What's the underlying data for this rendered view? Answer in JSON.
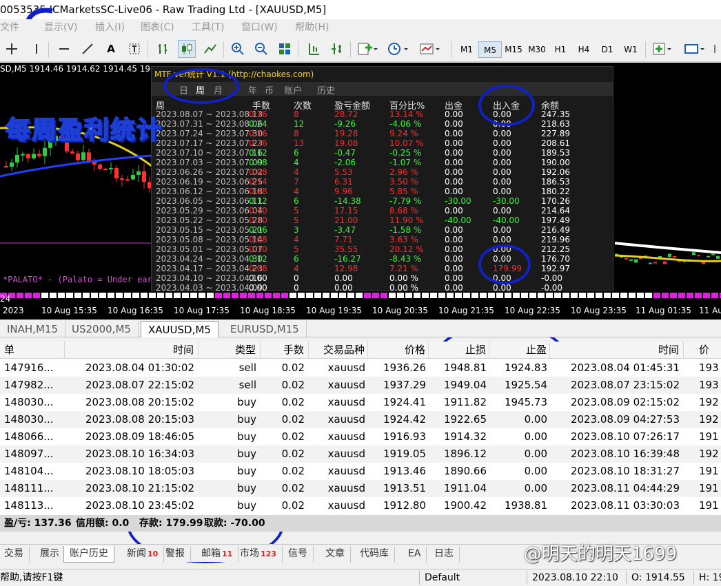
{
  "window": {
    "title": "0053535 ICMarketsSC-Live06 - Raw Trading Ltd - [XAUUSD,M5]"
  },
  "menu": {
    "items": [
      "文件",
      "显示(V)",
      "插入(I)",
      "图表(C)",
      "工具(T)",
      "窗口(W)",
      "帮助(H)"
    ]
  },
  "toolbar": {
    "timeframes": [
      "M1",
      "M5",
      "M15",
      "M30",
      "H1",
      "H4",
      "D1",
      "W1"
    ],
    "active_timeframe": "M5"
  },
  "chart": {
    "info": "SD,M5  1914.46 1914.62 1914.45 19",
    "indicator_text": "*PALATO* - (Palato = Under eart",
    "time_labels": [
      "24",
      "10 Aug 15:35",
      "10 Aug 16:35",
      "10 Aug 17:35",
      "10 Aug 18:35",
      "10 Aug 19:35",
      "10 Aug 20:35",
      "10 Aug 21:35",
      "10 Aug 22:35",
      "10 Aug 23:35",
      "11 Aug 01:35",
      "11 Aug"
    ],
    "time_prefix": "2023"
  },
  "stats_panel": {
    "title": "MTF     ver统计 V1.1   (http://chaokes.com)",
    "tabs": [
      "日",
      "周",
      "月",
      "年",
      "币",
      "账户",
      "历史"
    ],
    "active_tab": "周",
    "headers": [
      "周",
      "手数",
      "次数",
      "盈亏金额",
      "百分比%",
      "出金",
      "出入金",
      "余额"
    ],
    "rows": [
      {
        "week": "2023.08.07 ~ 2023.08.13",
        "lots": "0.16",
        "count": "8",
        "pl": "28.72",
        "pct": "13.14 %",
        "out": "0.00",
        "io": "0.00",
        "balance": "247.35",
        "pos": true
      },
      {
        "week": "2023.07.31 ~ 2023.08.06",
        "lots": "0.24",
        "count": "12",
        "pl": "-9.26",
        "pct": "-4.06 %",
        "out": "0.00",
        "io": "0.00",
        "balance": "218.63",
        "pos": false
      },
      {
        "week": "2023.07.24 ~ 2023.07.30",
        "lots": "0.16",
        "count": "8",
        "pl": "19.28",
        "pct": "9.24 %",
        "out": "0.00",
        "io": "0.00",
        "balance": "227.89",
        "pos": true
      },
      {
        "week": "2023.07.17 ~ 2023.07.23",
        "lots": "0.26",
        "count": "13",
        "pl": "19.08",
        "pct": "10.07 %",
        "out": "0.00",
        "io": "0.00",
        "balance": "208.61",
        "pos": true
      },
      {
        "week": "2023.07.10 ~ 2023.07.16",
        "lots": "0.12",
        "count": "6",
        "pl": "-0.47",
        "pct": "-0.25 %",
        "out": "0.00",
        "io": "0.00",
        "balance": "189.53",
        "pos": false
      },
      {
        "week": "2023.07.03 ~ 2023.07.09",
        "lots": "0.08",
        "count": "4",
        "pl": "-2.06",
        "pct": "-1.07 %",
        "out": "0.00",
        "io": "0.00",
        "balance": "190.00",
        "pos": false
      },
      {
        "week": "2023.06.26 ~ 2023.07.02",
        "lots": "0.08",
        "count": "4",
        "pl": "5.53",
        "pct": "2.96 %",
        "out": "0.00",
        "io": "0.00",
        "balance": "192.06",
        "pos": true
      },
      {
        "week": "2023.06.19 ~ 2023.06.25",
        "lots": "0.14",
        "count": "7",
        "pl": "6.31",
        "pct": "3.50 %",
        "out": "0.00",
        "io": "0.00",
        "balance": "186.53",
        "pos": true
      },
      {
        "week": "2023.06.12 ~ 2023.06.18",
        "lots": "0.08",
        "count": "4",
        "pl": "9.96",
        "pct": "5.85 %",
        "out": "0.00",
        "io": "0.00",
        "balance": "180.22",
        "pos": true
      },
      {
        "week": "2023.06.05 ~ 2023.06.11",
        "lots": "0.12",
        "count": "6",
        "pl": "-14.38",
        "pct": "-7.79 %",
        "out": "-30.00",
        "io": "-30.00",
        "balance": "170.26",
        "pos": false
      },
      {
        "week": "2023.05.29 ~ 2023.06.04",
        "lots": "0.10",
        "count": "5",
        "pl": "17.15",
        "pct": "8.68 %",
        "out": "0.00",
        "io": "0.00",
        "balance": "214.64",
        "pos": true
      },
      {
        "week": "2023.05.22 ~ 2023.05.28",
        "lots": "0.10",
        "count": "5",
        "pl": "21.00",
        "pct": "11.90 %",
        "out": "-40.00",
        "io": "-40.00",
        "balance": "197.49",
        "pos": true
      },
      {
        "week": "2023.05.15 ~ 2023.05.21",
        "lots": "0.06",
        "count": "3",
        "pl": "-3.47",
        "pct": "-1.58 %",
        "out": "0.00",
        "io": "0.00",
        "balance": "216.49",
        "pos": false
      },
      {
        "week": "2023.05.08 ~ 2023.05.14",
        "lots": "0.08",
        "count": "4",
        "pl": "7.71",
        "pct": "3.63 %",
        "out": "0.00",
        "io": "0.00",
        "balance": "219.96",
        "pos": true
      },
      {
        "week": "2023.05.01 ~ 2023.05.07",
        "lots": "0.10",
        "count": "5",
        "pl": "35.55",
        "pct": "20.12 %",
        "out": "0.00",
        "io": "0.00",
        "balance": "212.25",
        "pos": true
      },
      {
        "week": "2023.04.24 ~ 2023.04.30",
        "lots": "0.12",
        "count": "6",
        "pl": "-16.27",
        "pct": "-8.43 %",
        "out": "0.00",
        "io": "0.00",
        "balance": "176.70",
        "pos": false
      },
      {
        "week": "2023.04.17 ~ 2023.04.23",
        "lots": "0.08",
        "count": "4",
        "pl": "12.98",
        "pct": "7.21 %",
        "out": "0.00",
        "io": "179.99",
        "balance": "192.97",
        "pos": true
      },
      {
        "week": "2023.04.10 ~ 2023.04.16",
        "lots": "0.00",
        "count": "0",
        "pl": "0.00",
        "pct": "0.00 %",
        "out": "0.00",
        "io": "0.00",
        "balance": "-0.00",
        "pos": null
      },
      {
        "week": "2023.04.03 ~ 2023.04.09",
        "lots": "0.00",
        "count": "0",
        "pl": "0.00",
        "pct": "0.00 %",
        "out": "0.00",
        "io": "0.00",
        "balance": "-0.00",
        "pos": null
      }
    ]
  },
  "overlay": {
    "title": "每周盈利统计"
  },
  "chart_tabs": {
    "items": [
      "INAH,M15",
      "US2000,M5",
      "XAUUSD,M5",
      "EURUSD,M15"
    ],
    "active": "XAUUSD,M5"
  },
  "trades": {
    "headers": [
      "单",
      "时间",
      "类型",
      "手数",
      "交易品种",
      "价格",
      "止损",
      "止盈",
      "时间",
      "价"
    ],
    "rows": [
      [
        "147916...",
        "2023.08.04 01:30:02",
        "sell",
        "0.02",
        "xauusd",
        "1936.26",
        "1948.81",
        "1924.83",
        "2023.08.04 01:45:31",
        "193"
      ],
      [
        "147982...",
        "2023.08.07 22:15:02",
        "sell",
        "0.02",
        "xauusd",
        "1937.29",
        "1949.04",
        "1925.54",
        "2023.08.07 23:15:02",
        "193"
      ],
      [
        "148030...",
        "2023.08.08 20:15:02",
        "buy",
        "0.02",
        "xauusd",
        "1924.41",
        "1911.82",
        "1945.73",
        "2023.08.09 02:15:02",
        "192"
      ],
      [
        "148030...",
        "2023.08.08 20:15:03",
        "buy",
        "0.02",
        "xauusd",
        "1924.42",
        "1922.65",
        "0.00",
        "2023.08.09 04:27:53",
        "192"
      ],
      [
        "148066...",
        "2023.08.09 18:46:05",
        "buy",
        "0.02",
        "xauusd",
        "1916.93",
        "1914.32",
        "0.00",
        "2023.08.10 07:26:17",
        "191"
      ],
      [
        "148097...",
        "2023.08.10 16:34:03",
        "buy",
        "0.02",
        "xauusd",
        "1919.05",
        "1896.12",
        "0.00",
        "2023.08.10 16:39:48",
        "192"
      ],
      [
        "148104...",
        "2023.08.10 18:05:03",
        "buy",
        "0.02",
        "xauusd",
        "1913.46",
        "1890.66",
        "0.00",
        "2023.08.10 18:31:27",
        "191"
      ],
      [
        "148111...",
        "2023.08.10 21:15:02",
        "buy",
        "0.02",
        "xauusd",
        "1913.51",
        "1911.04",
        "0.00",
        "2023.08.11 04:44:29",
        "191"
      ],
      [
        "148113...",
        "2023.08.10 23:45:02",
        "buy",
        "0.02",
        "xauusd",
        "1912.80",
        "1900.42",
        "1938.81",
        "2023.08.11 03:30:03",
        "191"
      ]
    ]
  },
  "summary": {
    "pl": "盈/亏: 137.36",
    "credit": "信用额: 0.0",
    "deposit": "存款: 179.99",
    "withdraw": "取款: -70.00"
  },
  "bottom_tabs": {
    "items": [
      {
        "label": "交易",
        "badge": ""
      },
      {
        "label": "展示",
        "badge": ""
      },
      {
        "label": "账户历史",
        "badge": ""
      },
      {
        "label": "新闻",
        "badge": "10"
      },
      {
        "label": "警报",
        "badge": ""
      },
      {
        "label": "邮箱",
        "badge": "11"
      },
      {
        "label": "市场",
        "badge": "123"
      },
      {
        "label": "信号",
        "badge": ""
      },
      {
        "label": "文章",
        "badge": ""
      },
      {
        "label": "代码库",
        "badge": ""
      },
      {
        "label": "EA",
        "badge": ""
      },
      {
        "label": "日志",
        "badge": ""
      }
    ],
    "active": "账户历史"
  },
  "statusbar": {
    "help": "帮助,请按F1键",
    "profile": "Default",
    "datetime": "2023.08.10 22:10",
    "open": "O: 1914.55",
    "high": "H: 19"
  },
  "watermark": {
    "text": "@明天的明天1699"
  },
  "colors": {
    "positive": "#ff2a2a",
    "negative": "#2fff2f",
    "accent_circle": "#1220c8",
    "stats_title": "#ffd500"
  }
}
